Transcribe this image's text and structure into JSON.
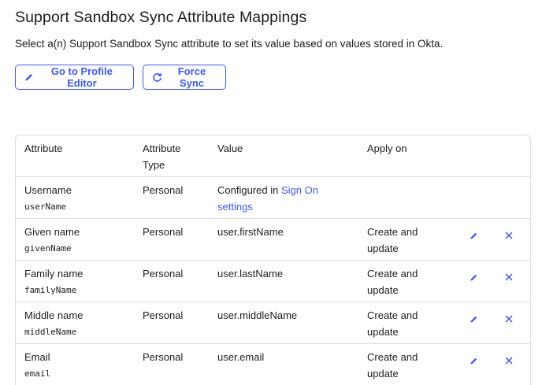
{
  "page": {
    "title": "Support Sandbox Sync Attribute Mappings",
    "subtitle": "Select a(n) Support Sandbox Sync attribute to set its value based on values stored in Okta."
  },
  "toolbar": {
    "profile_editor_label": "Go to Profile Editor",
    "force_sync_label": "Force Sync"
  },
  "table": {
    "headers": {
      "attribute": "Attribute",
      "type_line1": "Attribute",
      "type_line2": "Type",
      "value": "Value",
      "apply_on": "Apply on"
    },
    "rows": [
      {
        "name": "Username",
        "code": "userName",
        "type": "Personal",
        "value_prefix": "Configured in ",
        "value_link": "Sign On",
        "value_link2": "settings",
        "apply1": "",
        "apply2": ""
      },
      {
        "name": "Given name",
        "code": "givenName",
        "type": "Personal",
        "value": "user.firstName",
        "apply1": "Create and",
        "apply2": "update"
      },
      {
        "name": "Family name",
        "code": "familyName",
        "type": "Personal",
        "value": "user.lastName",
        "apply1": "Create and",
        "apply2": "update"
      },
      {
        "name": "Middle name",
        "code": "middleName",
        "type": "Personal",
        "value": "user.middleName",
        "apply1": "Create and",
        "apply2": "update"
      },
      {
        "name": "Email",
        "code": "email",
        "type": "Personal",
        "value": "user.email",
        "apply1": "Create and",
        "apply2": "update"
      }
    ]
  },
  "colors": {
    "accent": "#3f59e4",
    "border": "#dcdce0",
    "text": "#1d1d21"
  },
  "icons": {
    "edit": "pencil-icon",
    "delete": "close-icon",
    "profile": "pencil-icon",
    "sync": "refresh-icon"
  }
}
